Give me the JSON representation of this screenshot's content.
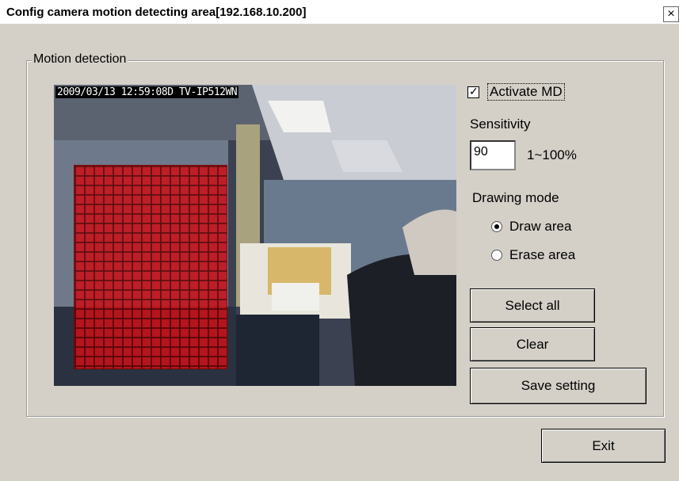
{
  "window": {
    "title": "Config camera motion detecting area[192.168.10.200]",
    "close_glyph": "×"
  },
  "group": {
    "label": "Motion detection"
  },
  "video": {
    "osd_text": "2009/03/13 12:59:08D TV-IP512WN",
    "overlay_color": "#c8121a"
  },
  "activate": {
    "label": "Activate MD",
    "checked": true,
    "check_glyph": "✓"
  },
  "sensitivity": {
    "label": "Sensitivity",
    "value": "90",
    "range_text": "1~100%"
  },
  "drawing_mode": {
    "label": "Drawing mode",
    "options": [
      {
        "label": "Draw area",
        "selected": true
      },
      {
        "label": "Erase area",
        "selected": false
      }
    ]
  },
  "buttons": {
    "select_all": "Select all",
    "clear": "Clear",
    "save": "Save setting",
    "exit": "Exit"
  },
  "colors": {
    "dialog_bg": "#d4d0c8",
    "accent_red": "#c8121a"
  }
}
